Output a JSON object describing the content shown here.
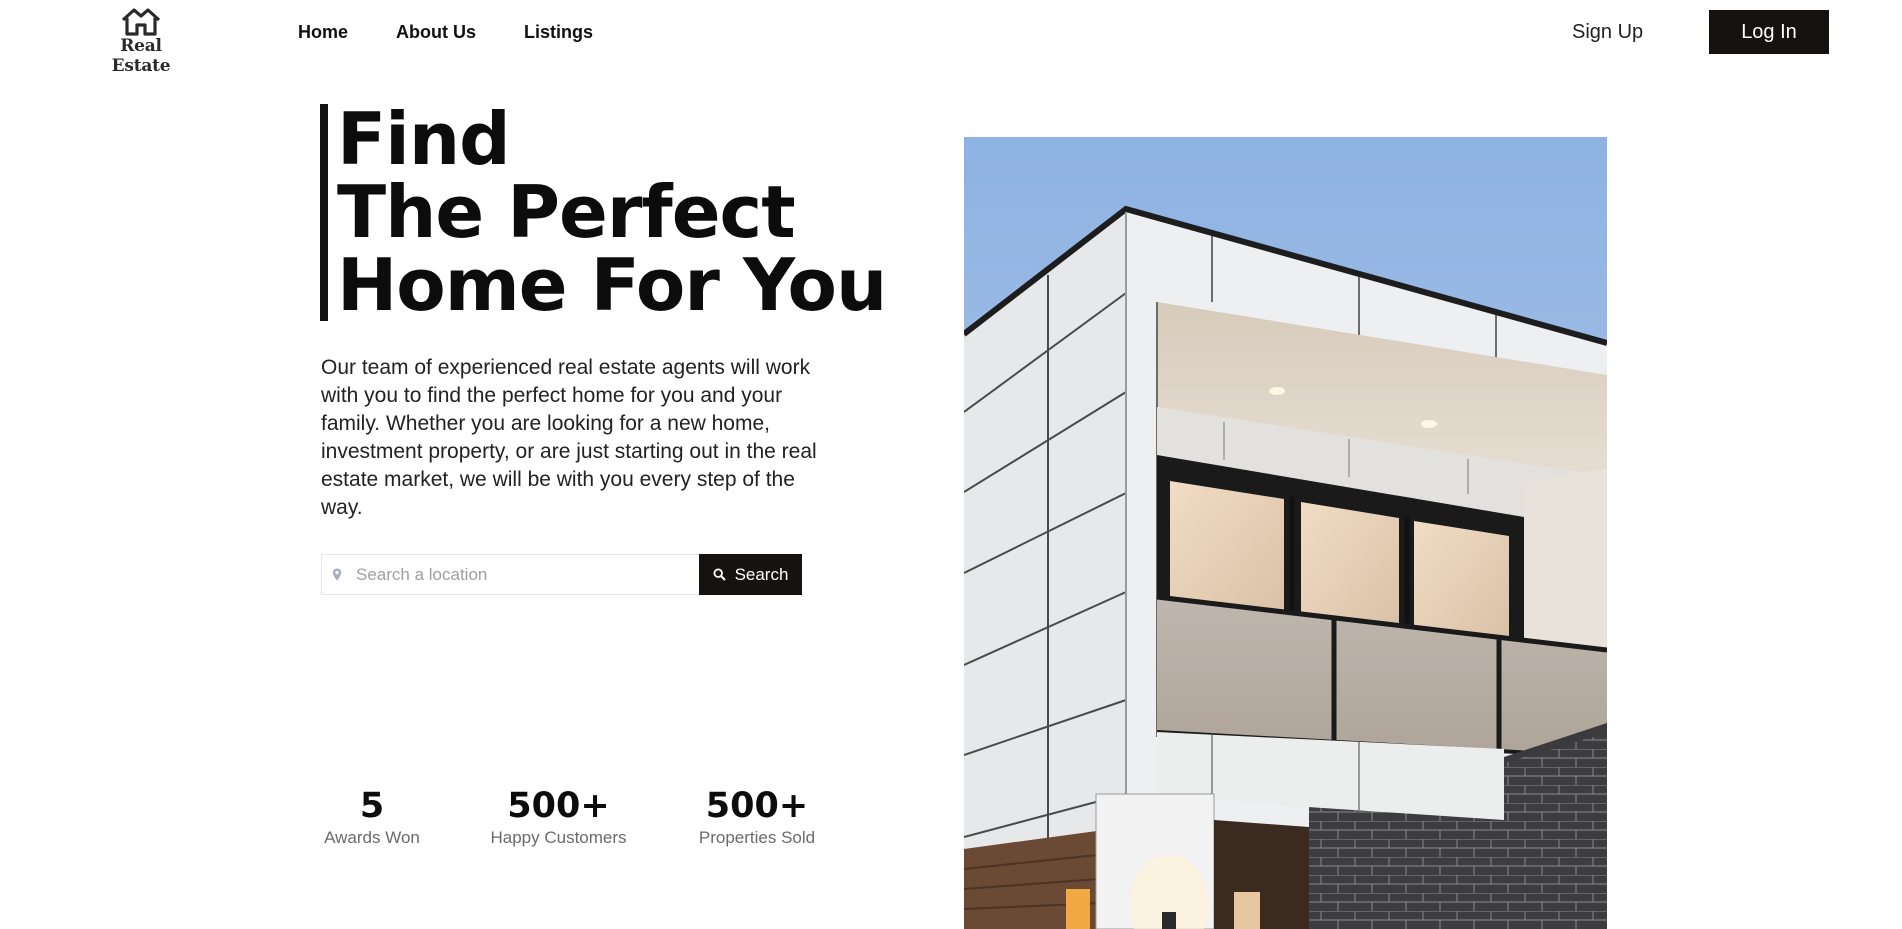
{
  "brand": {
    "name": "Real Estate",
    "icon": "house-outline-icon"
  },
  "nav": {
    "items": [
      {
        "label": "Home"
      },
      {
        "label": "About Us"
      },
      {
        "label": "Listings"
      }
    ]
  },
  "auth": {
    "signup_label": "Sign Up",
    "login_label": "Log In"
  },
  "hero": {
    "title_lines": [
      "Find",
      "The Perfect",
      "Home For You"
    ],
    "description": "Our team of experienced real estate agents will work with you to find the perfect home for you and your family. Whether you are looking for a new home, investment property, or are just starting out in the real estate market, we will be with you every step of the way."
  },
  "search": {
    "placeholder": "Search a location",
    "value": "",
    "button_label": "Search",
    "location_icon": "map-pin-icon",
    "button_icon": "search-icon"
  },
  "stats": [
    {
      "value": "5",
      "label": "Awards Won"
    },
    {
      "value": "500+",
      "label": "Happy Customers"
    },
    {
      "value": "500+",
      "label": "Properties Sold"
    }
  ],
  "colors": {
    "primary_dark": "#16120f",
    "text": "#111111",
    "muted": "#6b6b6b"
  }
}
